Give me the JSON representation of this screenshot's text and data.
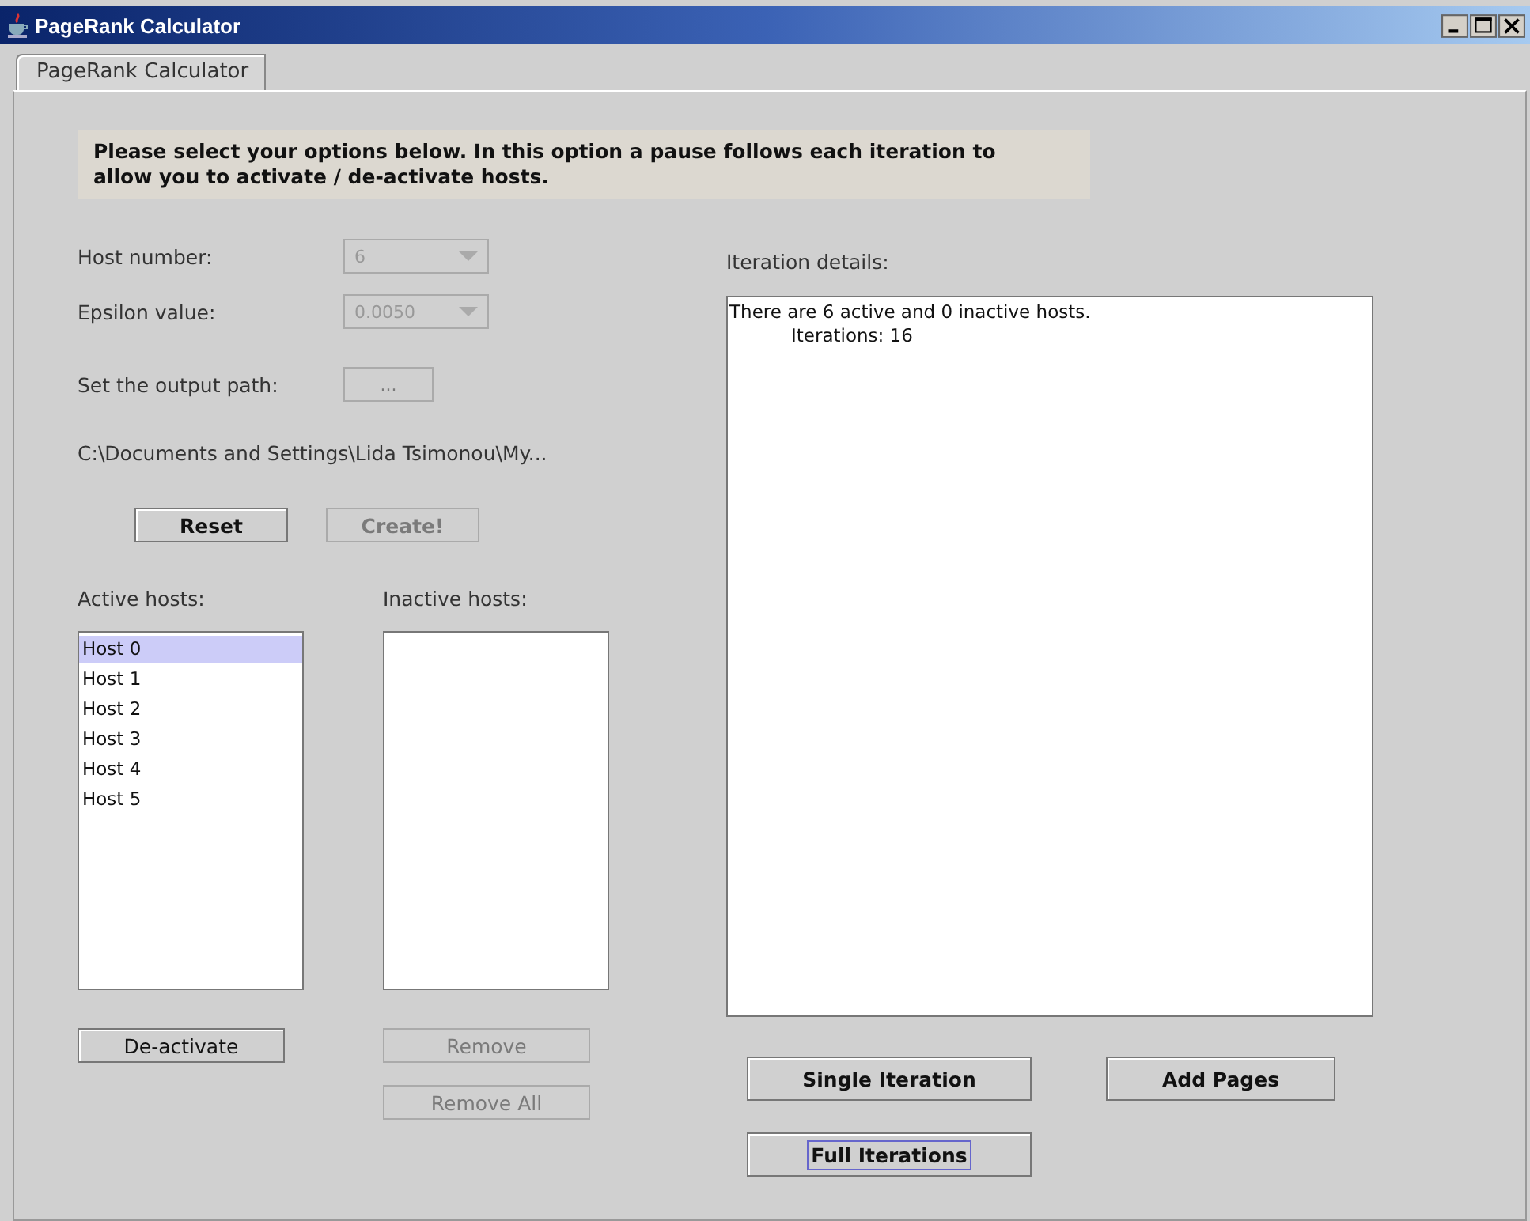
{
  "window": {
    "title": "PageRank Calculator"
  },
  "tabs": [
    {
      "label": "PageRank Calculator",
      "selected": true
    }
  ],
  "notice": "Please select your options below. In this option a pause follows each iteration to allow you to activate / de-activate hosts.",
  "host_number": {
    "label": "Host number:",
    "value": "6",
    "disabled": true
  },
  "epsilon": {
    "label": "Epsilon value:",
    "value": "0.0050",
    "disabled": true
  },
  "output_path": {
    "label": "Set the output path:",
    "button": "...",
    "disabled": true,
    "path": "C:\\Documents and Settings\\Lida Tsimonou\\My..."
  },
  "form_buttons": [
    {
      "label": "Reset",
      "disabled": false,
      "focused": false
    },
    {
      "label": "Create!",
      "disabled": true,
      "focused": false
    }
  ],
  "active_hosts": {
    "label": "Active hosts:",
    "items": [
      {
        "label": "Host 0",
        "selected": true
      },
      {
        "label": "Host 1",
        "selected": false
      },
      {
        "label": "Host 2",
        "selected": false
      },
      {
        "label": "Host 3",
        "selected": false
      },
      {
        "label": "Host 4",
        "selected": false
      },
      {
        "label": "Host 5",
        "selected": false
      }
    ]
  },
  "inactive_hosts": {
    "label": "Inactive hosts:"
  },
  "host_buttons": [
    {
      "label": "De-activate",
      "disabled": false,
      "focused": false
    },
    {
      "label": "Remove",
      "disabled": true,
      "focused": false
    },
    {
      "label": "Remove All",
      "disabled": true,
      "focused": false
    }
  ],
  "iteration_details": {
    "label": "Iteration details:",
    "lines": [
      "There are 6 active and 0 inactive hosts.",
      "Iterations: 16"
    ]
  },
  "iteration_buttons": [
    {
      "label": "Single Iteration",
      "disabled": false,
      "focused": false
    },
    {
      "label": "Add Pages",
      "disabled": false,
      "focused": false
    },
    {
      "label": "Full Iterations",
      "disabled": false,
      "focused": true
    }
  ]
}
